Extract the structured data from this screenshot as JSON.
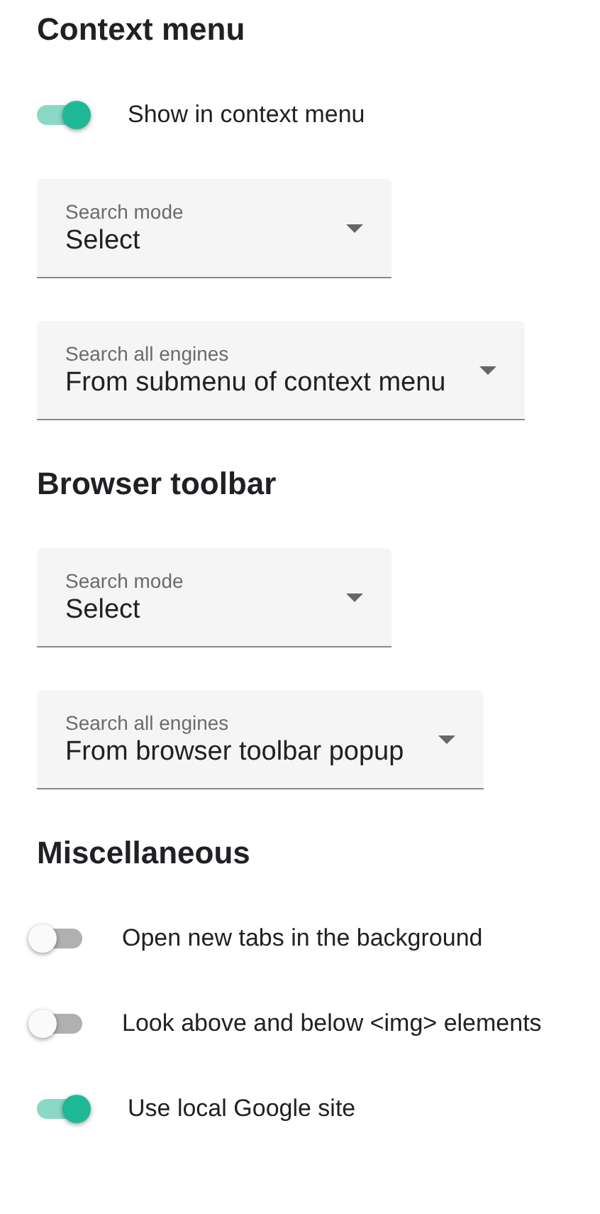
{
  "sections": [
    {
      "title": "Context menu",
      "items": [
        {
          "kind": "switch",
          "label": "Show in context menu",
          "on": true
        },
        {
          "kind": "select",
          "label": "Search mode",
          "value": "Select"
        },
        {
          "kind": "select",
          "label": "Search all engines",
          "value": "From submenu of context menu"
        }
      ]
    },
    {
      "title": "Browser toolbar",
      "items": [
        {
          "kind": "select",
          "label": "Search mode",
          "value": "Select"
        },
        {
          "kind": "select",
          "label": "Search all engines",
          "value": "From browser toolbar popup"
        }
      ]
    },
    {
      "title": "Miscellaneous",
      "items": [
        {
          "kind": "switch",
          "label": "Open new tabs in the background",
          "on": false
        },
        {
          "kind": "switch",
          "label": "Look above and below <img> elements",
          "on": false
        },
        {
          "kind": "switch",
          "label": "Use local Google site",
          "on": true
        }
      ]
    }
  ]
}
